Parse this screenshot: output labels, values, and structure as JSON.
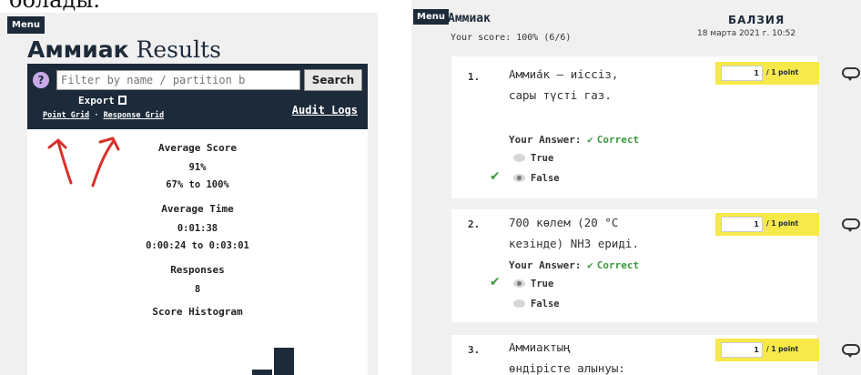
{
  "top_crop_text": "болады.",
  "left": {
    "menu_label": "Menu",
    "title_bold": "Аммиак",
    "title_rest": "Results",
    "help_icon_char": "?",
    "filter_placeholder": "Filter by name / partition b",
    "search_label": "Search",
    "export_label": "Export",
    "point_grid_label": "Point Grid",
    "separator": "·",
    "response_grid_label": "Response Grid",
    "audit_logs_label": "Audit Logs",
    "stats": {
      "avg_score_label": "Average Score",
      "avg_score_value": "91%",
      "avg_score_range": "67% to 100%",
      "avg_time_label": "Average Time",
      "avg_time_value": "0:01:38",
      "avg_time_range": "0:00:24 to 0:03:01",
      "responses_label": "Responses",
      "responses_value": "8",
      "histogram_label": "Score Histogram"
    },
    "histogram_bins": [
      0,
      0,
      0,
      0,
      0,
      0,
      1,
      0,
      2,
      5
    ],
    "annotation_color": "#d9302a"
  },
  "right": {
    "menu_label": "Menu",
    "quiz_title": "Аммиак",
    "score_text": "Your score: 100% (6/6)",
    "user_name": "БАЛЗИЯ",
    "date_text": "18 марта 2021 г. 10:52",
    "questions": [
      {
        "num": "1.",
        "text_line1": "Аммиа́к — иіссіз,",
        "text_line2": "сары түсті газ.",
        "points_value": "1",
        "points_label": "/ 1 point",
        "your_answer_label": "Your Answer:",
        "result": "Correct",
        "options": [
          "True",
          "False"
        ],
        "selected_index": 1
      },
      {
        "num": "2.",
        "text_line1": "700 көлем (20 °C",
        "text_line2": "кезінде) NH3 ериді.",
        "points_value": "1",
        "points_label": "/ 1 point",
        "your_answer_label": "Your Answer:",
        "result": "Correct",
        "options": [
          "True",
          "False"
        ],
        "selected_index": 0
      },
      {
        "num": "3.",
        "text_line1": "Аммиактың",
        "text_line2": "өндірісте алынуы:",
        "points_value": "1",
        "points_label": "/ 1 point"
      }
    ],
    "accent_yellow": "#f7e94a",
    "correct_green": "#3a9a3a",
    "navy": "#1c2a3a"
  }
}
